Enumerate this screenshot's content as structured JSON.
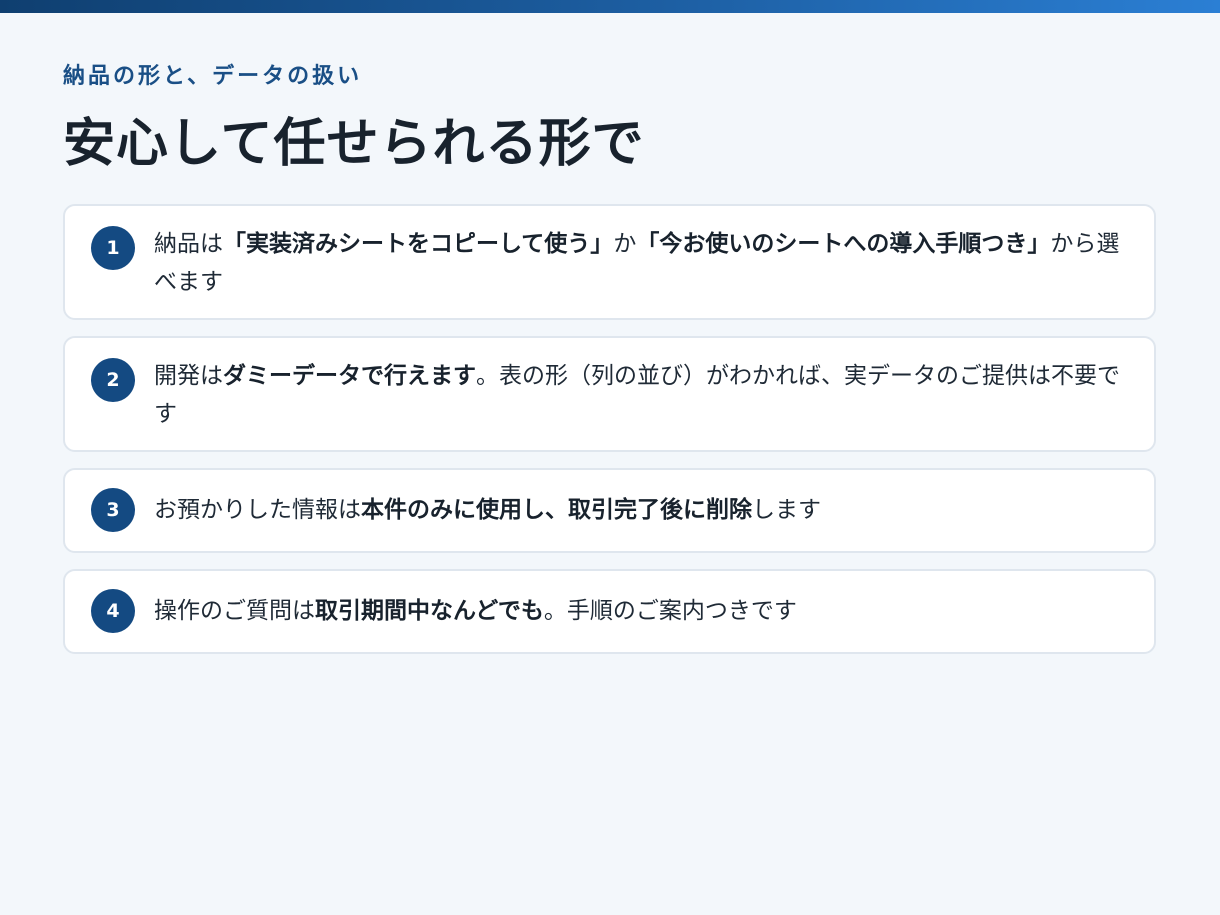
{
  "header": {
    "eyebrow": "納品の形と、データの扱い",
    "title": "安心して任せられる形で"
  },
  "colors": {
    "accent": "#144a82",
    "eyebrow": "#1a4f86",
    "background": "#f3f7fb",
    "card": "#ffffff",
    "card_border": "#dfe6ee",
    "top_bar_start": "#0f3f70",
    "top_bar_end": "#2b7fd4"
  },
  "items": [
    {
      "number": "1",
      "segments": [
        {
          "text": "納品は",
          "bold": false
        },
        {
          "text": "「実装済みシートをコピーして使う」",
          "bold": true
        },
        {
          "text": "か",
          "bold": false
        },
        {
          "text": "「今お使いのシートへの導入手順つき」",
          "bold": true
        },
        {
          "text": "から選べます",
          "bold": false
        }
      ]
    },
    {
      "number": "2",
      "segments": [
        {
          "text": "開発は",
          "bold": false
        },
        {
          "text": "ダミーデータで行えます",
          "bold": true
        },
        {
          "text": "。表の形（列の並び）がわかれば、実データのご提供は不要です",
          "bold": false
        }
      ]
    },
    {
      "number": "3",
      "segments": [
        {
          "text": "お預かりした情報は",
          "bold": false
        },
        {
          "text": "本件のみに使用し、取引完了後に削除",
          "bold": true
        },
        {
          "text": "します",
          "bold": false
        }
      ]
    },
    {
      "number": "4",
      "segments": [
        {
          "text": "操作のご質問は",
          "bold": false
        },
        {
          "text": "取引期間中なんどでも",
          "bold": true
        },
        {
          "text": "。手順のご案内つきです",
          "bold": false
        }
      ]
    }
  ]
}
